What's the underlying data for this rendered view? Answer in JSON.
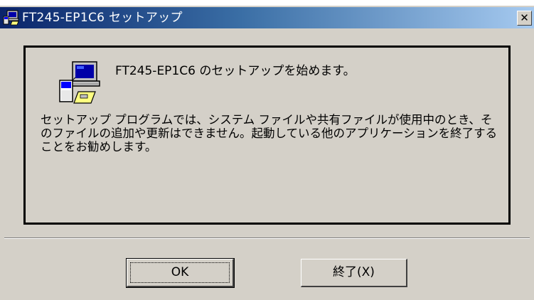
{
  "window": {
    "title": "FT245-EP1C6 セットアップ",
    "close_glyph": "✕"
  },
  "content": {
    "heading": "FT245-EP1C6 のセットアップを始めます。",
    "message": "セットアップ プログラムでは、システム ファイルや共有ファイルが使用中のとき、そのファイルの追加や更新はできません。起動している他のアプリケーションを終了することをお勧めします。"
  },
  "buttons": {
    "ok_label": "OK",
    "exit_label": "終了(X)"
  },
  "colors": {
    "dialog_face": "#d4d0c8",
    "titlebar_start": "#0a246a",
    "titlebar_end": "#a6caf0"
  },
  "icons": {
    "title": "setup-computer-icon",
    "main": "setup-computer-icon",
    "close": "close-icon"
  }
}
